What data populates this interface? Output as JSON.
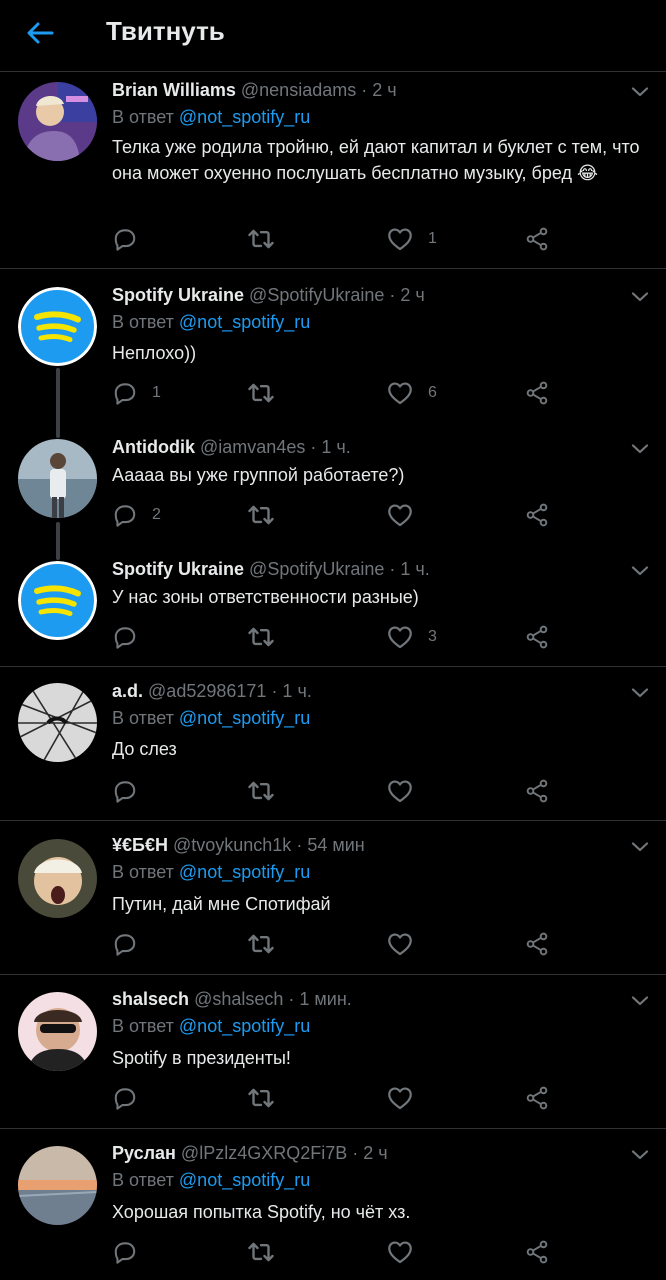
{
  "header": {
    "title": "Твитнуть"
  },
  "colors": {
    "background": "#000000",
    "accent": "#1d9bf0",
    "muted": "#71767b",
    "divider": "#2f3336",
    "spotify_yellow": "#f5e400",
    "spotify_blue": "#1d9bf0"
  },
  "icons": {
    "back": "arrow-left-icon",
    "reply": "reply-icon",
    "retweet": "retweet-icon",
    "like": "heart-icon",
    "share": "share-icon",
    "more": "chevron-down-icon"
  },
  "tweets": [
    {
      "name": "Brian Williams",
      "handle": "@nensiadams",
      "time": "· 2 ч",
      "reply_prefix": "В ответ",
      "reply_to": "@not_spotify_ru",
      "text": "Телка уже родила тройню, ей дают капитал и буклет с тем, что она может охуенно послушать бесплатно музыку, бред 😂",
      "replies": "",
      "likes": "1"
    },
    {
      "name": "Spotify Ukraine",
      "handle": "@SpotifyUkraine",
      "time": "· 2 ч",
      "reply_prefix": "В ответ",
      "reply_to": "@not_spotify_ru",
      "text": "Неплохо))",
      "replies": "1",
      "likes": "6"
    },
    {
      "name": "Antidodik",
      "handle": "@iamvan4es",
      "time": "· 1 ч.",
      "text": "Ааааа вы уже группой работаете?)",
      "replies": "2",
      "likes": ""
    },
    {
      "name": "Spotify Ukraine",
      "handle": "@SpotifyUkraine",
      "time": "· 1 ч.",
      "text": "У нас зоны ответственности разные)",
      "replies": "",
      "likes": "3"
    },
    {
      "name": "a.d.",
      "handle": "@ad52986171",
      "time": "· 1 ч.",
      "reply_prefix": "В ответ",
      "reply_to": "@not_spotify_ru",
      "text": "До слез",
      "replies": "",
      "likes": ""
    },
    {
      "name": "¥€Б€H",
      "handle": "@tvoykunch1k",
      "time": "· 54 мин",
      "reply_prefix": "В ответ",
      "reply_to": "@not_spotify_ru",
      "text": "Путин, дай мне Спотифай",
      "replies": "",
      "likes": ""
    },
    {
      "name": "shalsech",
      "handle": "@shalsech",
      "time": "· 1 мин.",
      "reply_prefix": "В ответ",
      "reply_to": "@not_spotify_ru",
      "text": "Spotify в президенты!",
      "replies": "",
      "likes": ""
    },
    {
      "name": "Руслан",
      "handle": "@lPzlz4GXRQ2Fi7B",
      "time": "· 2 ч",
      "reply_prefix": "В ответ",
      "reply_to": "@not_spotify_ru",
      "text": "Хорошая попытка Spotify, но чёт хз.",
      "replies": "",
      "likes": ""
    }
  ]
}
